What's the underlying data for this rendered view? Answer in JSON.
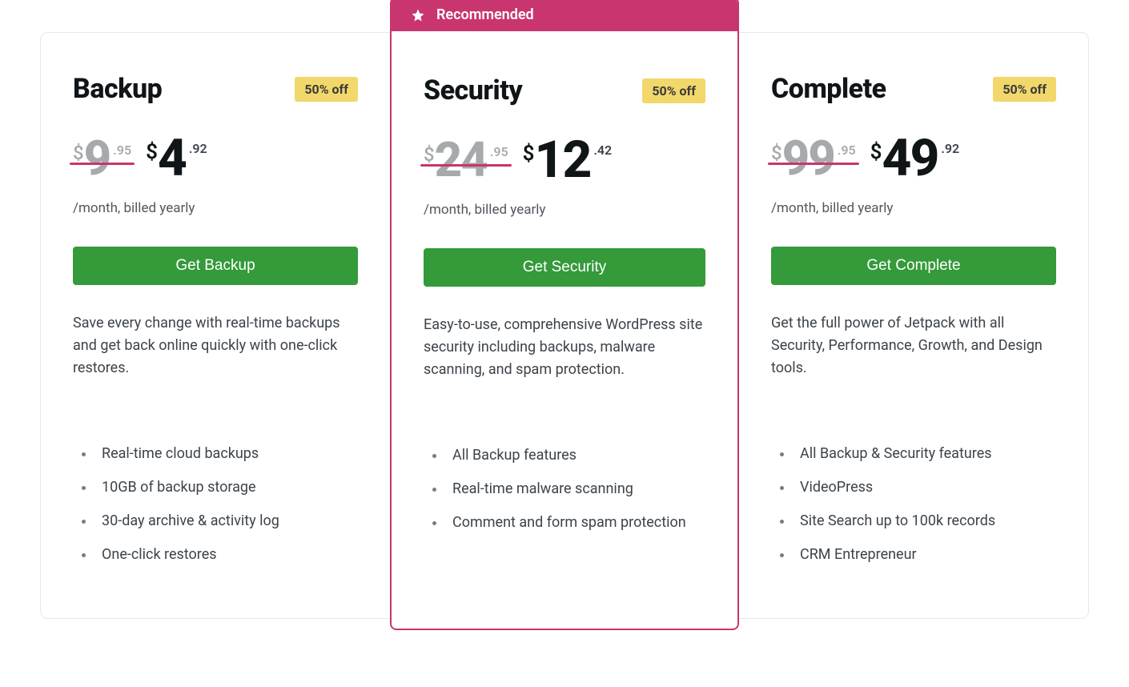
{
  "recommended_label": "Recommended",
  "plans": [
    {
      "title": "Backup",
      "discount": "50% off",
      "old_currency": "$",
      "old_whole": "9",
      "old_cents": ".95",
      "new_currency": "$",
      "new_whole": "4",
      "new_cents": ".92",
      "billing": "/month, billed yearly",
      "cta": "Get Backup",
      "description": "Save every change with real-time backups and get back online quickly with one-click restores.",
      "features": [
        "Real-time cloud backups",
        "10GB of backup storage",
        "30-day archive & activity log",
        "One-click restores"
      ]
    },
    {
      "title": "Security",
      "discount": "50% off",
      "old_currency": "$",
      "old_whole": "24",
      "old_cents": ".95",
      "new_currency": "$",
      "new_whole": "12",
      "new_cents": ".42",
      "billing": "/month, billed yearly",
      "cta": "Get Security",
      "description": "Easy-to-use, comprehensive WordPress site security including backups, malware scanning, and spam protection.",
      "features": [
        "All Backup features",
        "Real-time malware scanning",
        "Comment and form spam protection"
      ]
    },
    {
      "title": "Complete",
      "discount": "50% off",
      "old_currency": "$",
      "old_whole": "99",
      "old_cents": ".95",
      "new_currency": "$",
      "new_whole": "49",
      "new_cents": ".92",
      "billing": "/month, billed yearly",
      "cta": "Get Complete",
      "description": "Get the full power of Jetpack with all Security, Performance, Growth, and Design tools.",
      "features": [
        "All Backup & Security features",
        "VideoPress",
        "Site Search up to 100k records",
        "CRM Entrepreneur"
      ]
    }
  ]
}
